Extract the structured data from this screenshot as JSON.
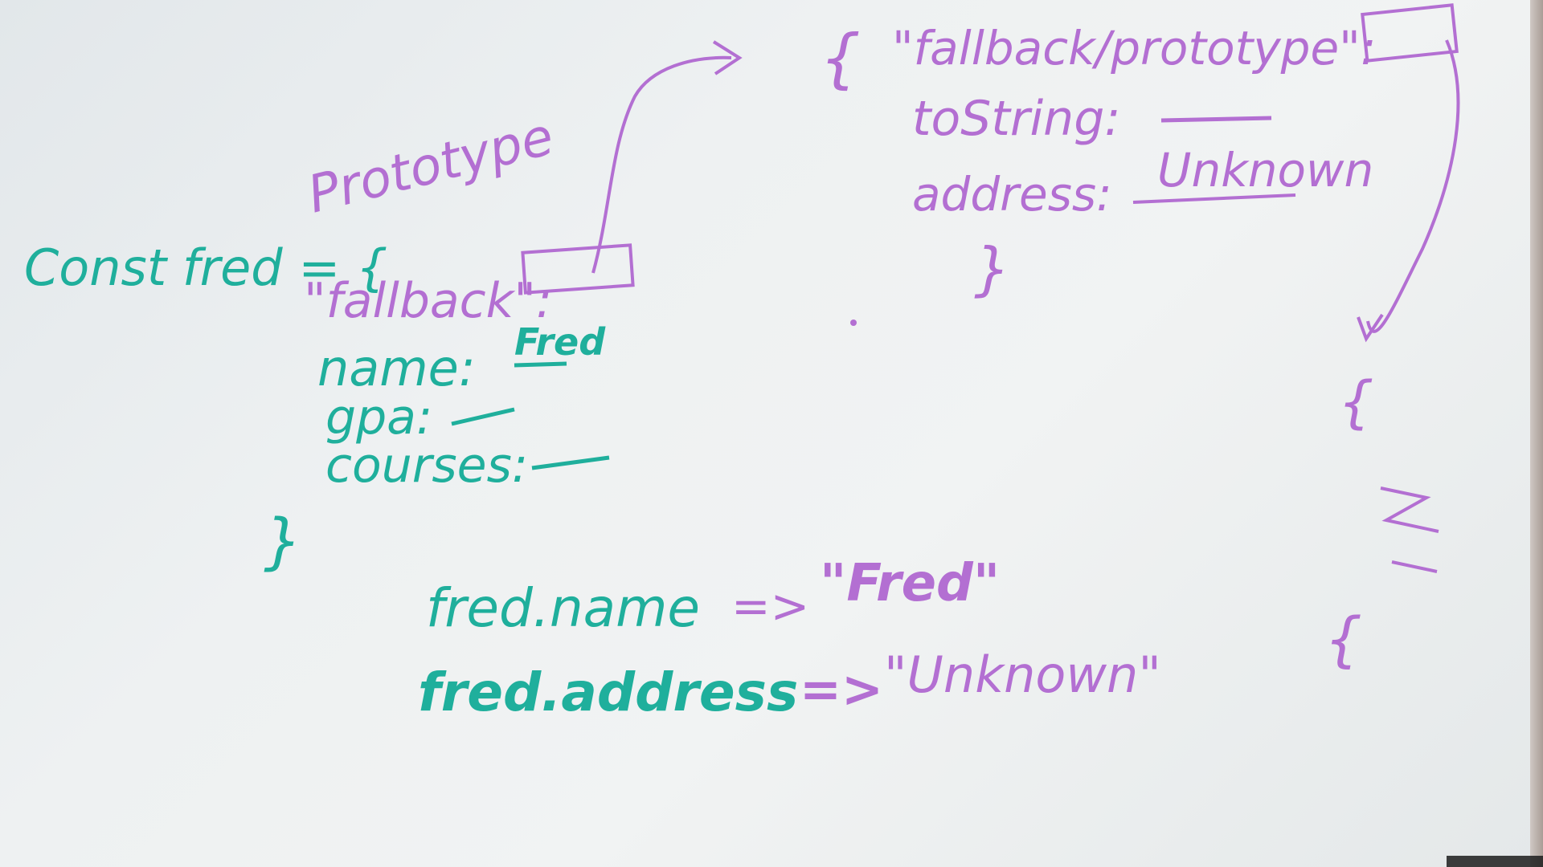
{
  "board": {
    "left_object": {
      "declaration": "Const fred = {",
      "prototype_label": "Prototype",
      "fallback_key": "\"fallback\":",
      "name_key": "name:",
      "name_value": "Fred",
      "gpa_key": "gpa:",
      "courses_key": "courses:",
      "close_brace": "}"
    },
    "right_object": {
      "open_brace": "{",
      "fallback_prototype_key": "\"fallback/prototype\":",
      "tostring_key": "toString:",
      "address_key": "address:",
      "address_value": "Unknown",
      "close_brace": "}"
    },
    "evaluations": [
      {
        "expression": "fred.name",
        "arrow": "=>",
        "result": "\"Fred\""
      },
      {
        "expression": "fred.address",
        "arrow": "=>",
        "result": "\"Unknown\""
      }
    ],
    "right_column_brace_top": "{",
    "right_column_brace_bottom": "{",
    "colors": {
      "teal_marker": "#1faf9c",
      "purple_marker": "#b36fd2",
      "board_background": "#eef1f2"
    }
  }
}
